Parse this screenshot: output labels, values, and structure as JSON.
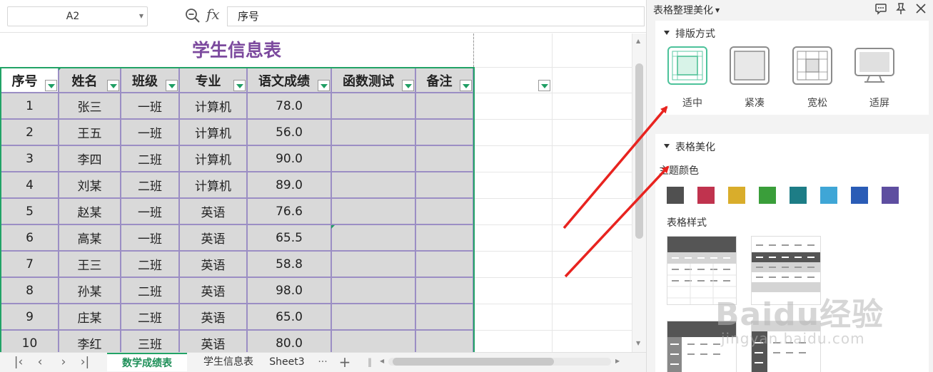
{
  "formula_bar": {
    "name_box": "A2",
    "formula_value": "序号"
  },
  "sheet": {
    "title": "学生信息表",
    "headers": [
      "序号",
      "姓名",
      "班级",
      "专业",
      "语文成绩",
      "函数测试",
      "备注"
    ],
    "rows": [
      [
        "1",
        "张三",
        "一班",
        "计算机",
        "78.0",
        "",
        ""
      ],
      [
        "2",
        "王五",
        "一班",
        "计算机",
        "56.0",
        "",
        ""
      ],
      [
        "3",
        "李四",
        "二班",
        "计算机",
        "90.0",
        "",
        ""
      ],
      [
        "4",
        "刘某",
        "二班",
        "计算机",
        "89.0",
        "",
        ""
      ],
      [
        "5",
        "赵某",
        "一班",
        "英语",
        "76.6",
        "",
        ""
      ],
      [
        "6",
        "高某",
        "一班",
        "英语",
        "65.5",
        "",
        ""
      ],
      [
        "7",
        "王三",
        "二班",
        "英语",
        "58.8",
        "",
        ""
      ],
      [
        "8",
        "孙某",
        "二班",
        "英语",
        "98.0",
        "",
        ""
      ],
      [
        "9",
        "庄某",
        "二班",
        "英语",
        "65.0",
        "",
        ""
      ],
      [
        "10",
        "李红",
        "三班",
        "英语",
        "80.0",
        "",
        ""
      ]
    ]
  },
  "sheet_tabs": [
    "数学成绩表",
    "学生信息表",
    "Sheet3"
  ],
  "more_tabs": "···",
  "add_tab": "+",
  "panel": {
    "title": "表格整理美化",
    "layout_section": "排版方式",
    "layout_options": [
      "适中",
      "紧凑",
      "宽松",
      "适屏"
    ],
    "beautify_section": "表格美化",
    "theme_color_label": "主题颜色",
    "theme_colors": [
      "#505050",
      "#c0334e",
      "#d9ad2b",
      "#3a9e3a",
      "#1d7d86",
      "#3fa6d6",
      "#2a5cb6",
      "#5e4ea0"
    ],
    "table_style_label": "表格样式"
  },
  "watermark": {
    "brand": "Baidu经验",
    "url": "jingyan.baidu.com"
  }
}
